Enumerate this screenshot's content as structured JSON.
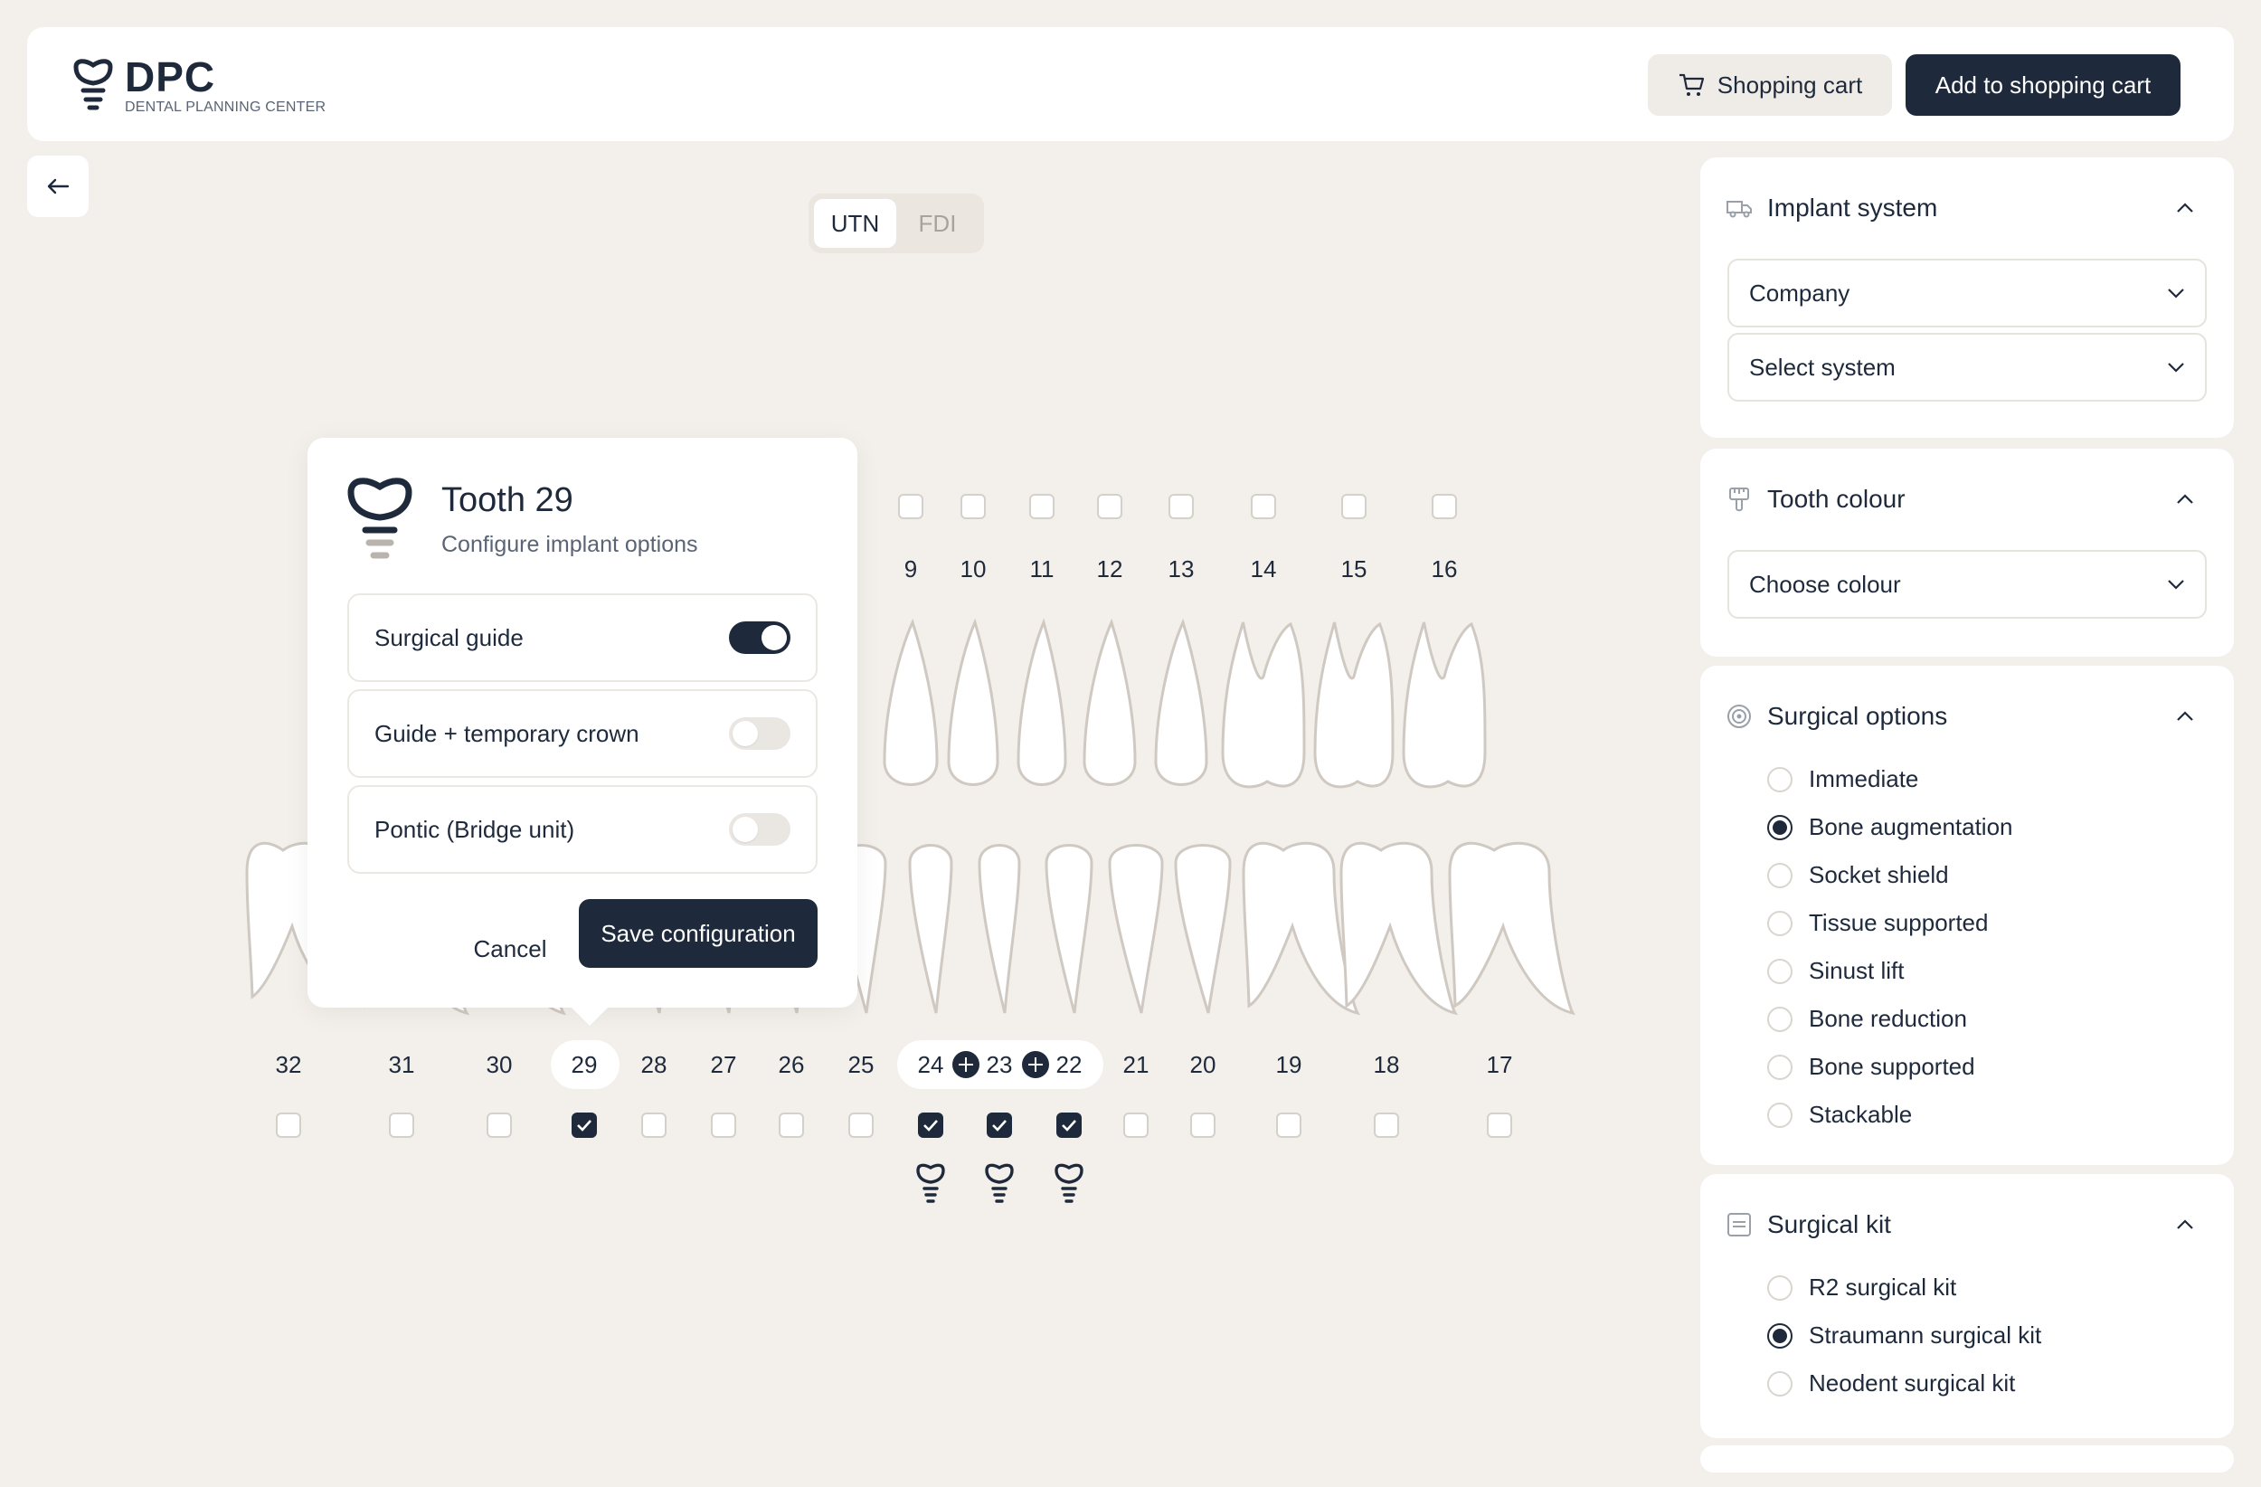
{
  "header": {
    "logo_title": "DPC",
    "logo_subtitle": "DENTAL PLANNING CENTER",
    "cart_label": "Shopping cart",
    "add_label": "Add to shopping cart"
  },
  "notation": {
    "options": [
      "UTN",
      "FDI"
    ],
    "active": "UTN"
  },
  "upper_teeth": [
    "9",
    "10",
    "11",
    "12",
    "13",
    "14",
    "15",
    "16"
  ],
  "lower_teeth": [
    "32",
    "31",
    "30",
    "29",
    "28",
    "27",
    "26",
    "25",
    "24",
    "23",
    "22",
    "21",
    "20",
    "19",
    "18",
    "17"
  ],
  "lower_checked": [
    "29",
    "24",
    "23",
    "22"
  ],
  "implant_teeth": [
    "24",
    "23",
    "22"
  ],
  "popup": {
    "title": "Tooth 29",
    "subtitle": "Configure implant options",
    "options": [
      {
        "label": "Surgical guide",
        "on": true
      },
      {
        "label": "Guide + temporary crown",
        "on": false
      },
      {
        "label": "Pontic (Bridge unit)",
        "on": false
      }
    ],
    "cancel_label": "Cancel",
    "save_label": "Save configuration"
  },
  "panel": {
    "implant_system": {
      "title": "Implant system",
      "company": "Company",
      "system": "Select system"
    },
    "tooth_colour": {
      "title": "Tooth colour",
      "choose": "Choose colour"
    },
    "surgical_options": {
      "title": "Surgical options",
      "items": [
        "Immediate",
        "Bone augmentation",
        "Socket shield",
        "Tissue supported",
        "Sinust lift",
        "Bone reduction",
        "Bone supported",
        "Stackable"
      ],
      "selected": "Bone augmentation"
    },
    "surgical_kit": {
      "title": "Surgical kit",
      "items": [
        "R2 surgical kit",
        "Straumann surgical kit",
        "Neodent surgical kit"
      ],
      "selected": "Straumann surgical kit"
    }
  },
  "colors": {
    "primary": "#1e2a3b",
    "background": "#f3efea",
    "outline": "#cfc9c2"
  }
}
